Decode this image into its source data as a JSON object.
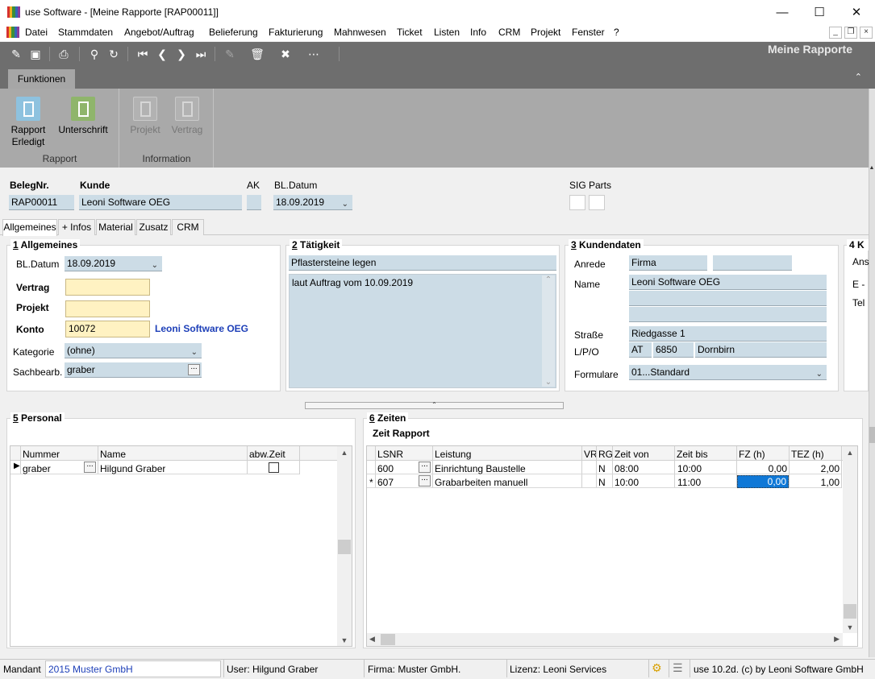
{
  "window": {
    "title": "use Software - [Meine Rapporte [RAP00011]]"
  },
  "menu": [
    "Datei",
    "Stammdaten",
    "Angebot/Auftrag",
    "Belieferung",
    "Fakturierung",
    "Mahnwesen",
    "Ticket",
    "Listen",
    "Info",
    "CRM",
    "Projekt",
    "Fenster",
    "?"
  ],
  "panel_title": "Meine Rapporte",
  "ribbon": {
    "tab": "Funktionen",
    "groups": [
      {
        "label": "Rapport",
        "buttons": [
          {
            "line1": "Rapport",
            "line2": "Erledigt",
            "color": "#8ec2df"
          },
          {
            "line1": "Unterschrift",
            "line2": "",
            "color": "#8fb56b"
          }
        ]
      },
      {
        "label": "Information",
        "buttons": [
          {
            "line1": "Projekt",
            "line2": "",
            "color": "#b2b2b2"
          },
          {
            "line1": "Vertrag",
            "line2": "",
            "color": "#b2b2b2"
          }
        ]
      }
    ]
  },
  "header": {
    "belegnr_label": "BelegNr.",
    "belegnr": "RAP00011",
    "kunde_label": "Kunde",
    "kunde": "Leoni Software OEG",
    "ak_label": "AK",
    "ak": "",
    "datum_label": "BL.Datum",
    "datum": "18.09.2019",
    "sig_label": "SIG",
    "parts_label": "Parts"
  },
  "tabs": [
    "Allgemeines",
    "+ Infos",
    "Material",
    "Zusatz",
    "CRM"
  ],
  "allgemeines": {
    "title_num": "1",
    "title": "Allgemeines",
    "datum_label": "BL.Datum",
    "datum": "18.09.2019",
    "vertrag_label": "Vertrag",
    "vertrag": "",
    "projekt_label": "Projekt",
    "projekt": "",
    "konto_label": "Konto",
    "konto": "10072",
    "konto_name": "Leoni Software OEG",
    "kategorie_label": "Kategorie",
    "kategorie": "(ohne)",
    "sachbearb_label": "Sachbearb.",
    "sachbearb": "graber"
  },
  "taetigkeit": {
    "title_num": "2",
    "title": "Tätigkeit",
    "line": "Pflastersteine legen",
    "text": "laut Auftrag vom 10.09.2019"
  },
  "kundendaten": {
    "title_num": "3",
    "title": "Kundendaten",
    "anrede_label": "Anrede",
    "anrede": "Firma",
    "anrede2": "",
    "name_label": "Name",
    "name1": "Leoni Software OEG",
    "name2": "",
    "name3": "",
    "strasse_label": "Straße",
    "strasse": "Riedgasse 1",
    "lpo_label": "L/P/O",
    "land": "AT",
    "plz": "6850",
    "ort": "Dornbirn",
    "formulare_label": "Formulare",
    "formulare": "01...Standard"
  },
  "g4": {
    "title": "4 K",
    "l1": "Ans",
    "l2": "E -",
    "l3": "Tel"
  },
  "personal": {
    "title_num": "5",
    "title": "Personal",
    "columns": [
      "Nummer",
      "Name",
      "abw.Zeit"
    ],
    "rows": [
      {
        "nummer": "graber",
        "name": "Hilgund Graber",
        "abw": false
      }
    ]
  },
  "zeiten": {
    "title_num": "6",
    "title": "Zeiten",
    "subtitle": "Zeit Rapport",
    "columns": [
      "LSNR",
      "Leistung",
      "VR",
      "RG",
      "Zeit von",
      "Zeit bis",
      "FZ (h)",
      "TEZ (h)"
    ],
    "rows": [
      {
        "marker": "",
        "lsnr": "600",
        "leistung": "Einrichtung Baustelle",
        "vr": "",
        "rg": "N",
        "von": "08:00",
        "bis": "10:00",
        "fz": "0,00",
        "tez": "2,00"
      },
      {
        "marker": "*",
        "lsnr": "607",
        "leistung": "Grabarbeiten manuell",
        "vr": "",
        "rg": "N",
        "von": "10:00",
        "bis": "11:00",
        "fz": "0,00",
        "tez": "1,00"
      }
    ]
  },
  "status": {
    "mandant_label": "Mandant",
    "mandant": "2015 Muster GmbH",
    "user": "User: Hilgund Graber",
    "firma": "Firma: Muster GmbH.",
    "lizenz": "Lizenz: Leoni Services",
    "version": "use 10.2d. (c) by Leoni Software GmbH"
  }
}
